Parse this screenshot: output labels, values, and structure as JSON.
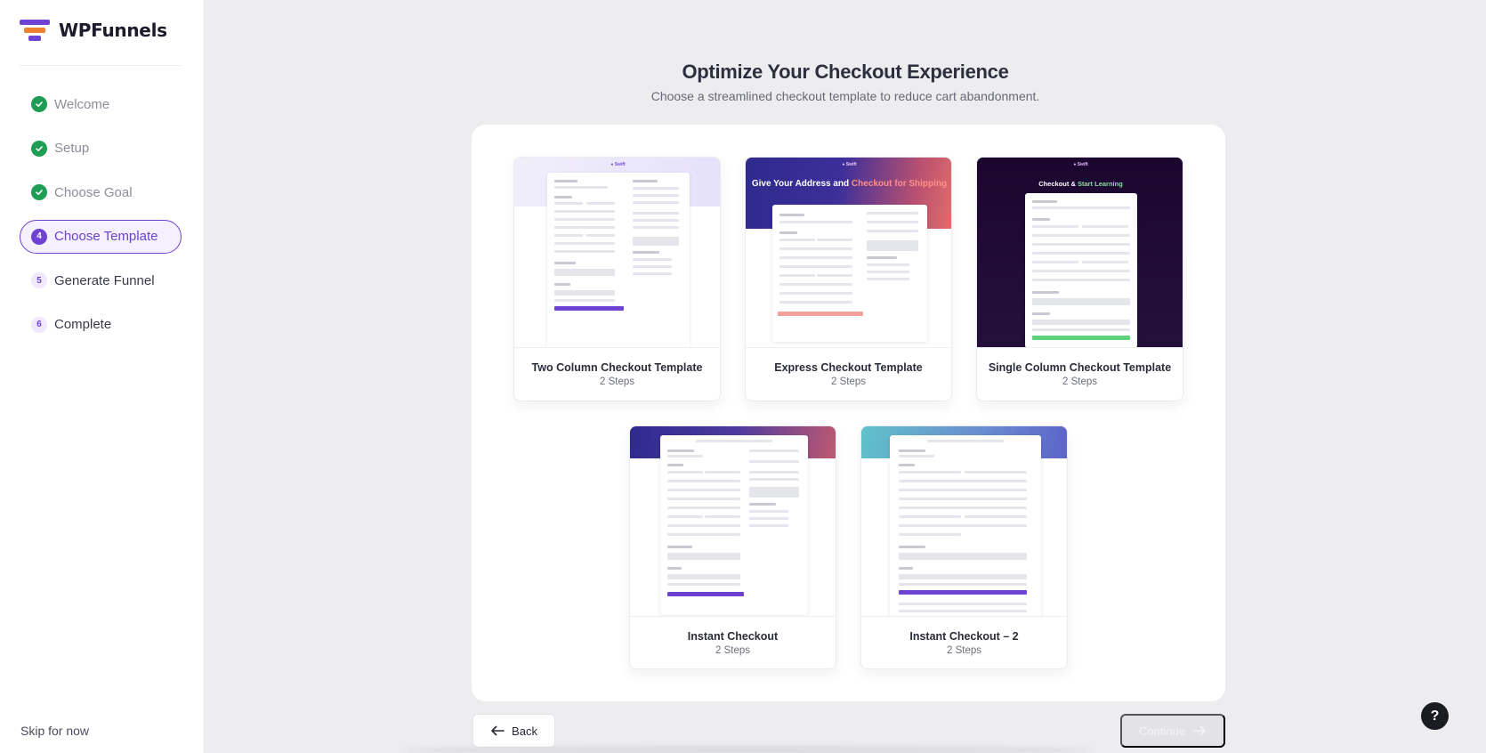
{
  "brand": {
    "name": "WPFunnels"
  },
  "steps": [
    {
      "label": "Welcome",
      "status": "done"
    },
    {
      "label": "Setup",
      "status": "done"
    },
    {
      "label": "Choose Goal",
      "status": "done"
    },
    {
      "label": "Choose Template",
      "status": "active",
      "number": "4"
    },
    {
      "label": "Generate Funnel",
      "status": "pending",
      "number": "5"
    },
    {
      "label": "Complete",
      "status": "pending",
      "number": "6"
    }
  ],
  "skip_label": "Skip for now",
  "header": {
    "title": "Optimize Your Checkout Experience",
    "subtitle": "Choose a streamlined checkout template to reduce cart abandonment."
  },
  "templates": [
    {
      "name": "Two Column Checkout Template",
      "steps": "2 Steps"
    },
    {
      "name": "Express Checkout Template",
      "steps": "2 Steps",
      "hero_text_a": "Give Your Address and",
      "hero_text_b": "Checkout for Shipping"
    },
    {
      "name": "Single Column Checkout Template",
      "steps": "2 Steps",
      "hero_text_a": "Checkout &",
      "hero_text_b": "Start Learning"
    },
    {
      "name": "Instant Checkout",
      "steps": "2 Steps"
    },
    {
      "name": "Instant Checkout – 2",
      "steps": "2 Steps"
    }
  ],
  "footer": {
    "back_label": "Back",
    "continue_label": "Continue",
    "help_label": "?"
  },
  "colors": {
    "accent": "#6e42d3",
    "done": "#1f9d55",
    "brand_orange": "#ee8134"
  }
}
